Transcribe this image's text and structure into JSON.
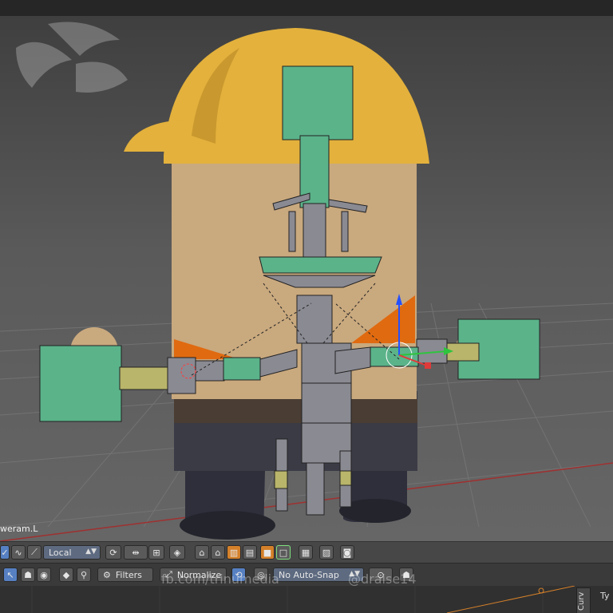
{
  "viewport": {
    "active_object": "weram.L"
  },
  "header3d": {
    "pivot": "Local",
    "icons": [
      "select-mode-icon",
      "curve-icon",
      "pose-icon",
      "transform-orientation",
      "proportional-icon",
      "manipulator-icon",
      "layer-icon",
      "render-icons"
    ]
  },
  "timeline": {
    "filters_label": "Filters",
    "normalize_label": "Normalize",
    "snap_label": "No Auto-Snap",
    "side_tab": "Curv",
    "corner_text": "Ty"
  },
  "watermark": {
    "facebook": "fb.com/trinumedia",
    "twitter": "@draise14"
  },
  "colors": {
    "helmet": "#e3b13c",
    "face": "#c9a97e",
    "body": "#2e2f3b",
    "bone_green": "#5bb38a",
    "bone_gray": "#8a8a93",
    "accent_orange": "#e06a10"
  }
}
